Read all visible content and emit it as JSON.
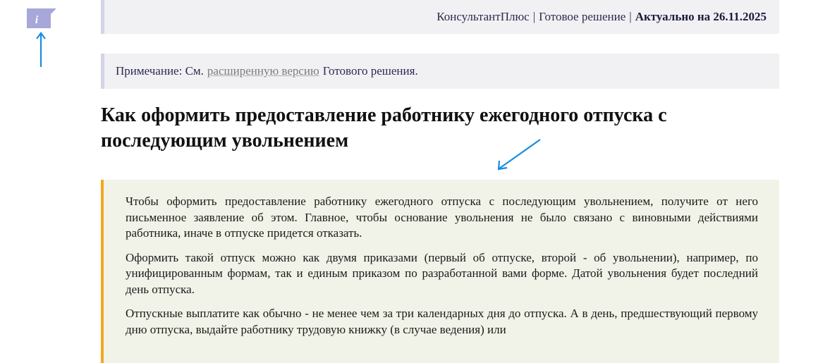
{
  "icons": {
    "info_icon": "info-icon",
    "annotation_arrow_up": "arrow-up-icon",
    "annotation_arrow_diagonal": "arrow-diagonal-icon",
    "info_glyph": "i"
  },
  "colors": {
    "header_bg": "#f1f1f4",
    "header_border": "#d4d4e8",
    "summary_bg": "#f1f3e8",
    "summary_border": "#f4a623",
    "annotation_arrow": "#1a8ce0",
    "info_icon": "#a7a7da"
  },
  "header": {
    "source": "КонсультантПлюс",
    "separator": "|",
    "doc_type": "Готовое решение",
    "actual_label": "Актуально на 26.11.2025"
  },
  "note": {
    "prefix": "Примечание: См.",
    "link_text": "расширенную версию",
    "suffix": "Готового решения."
  },
  "title": "Как оформить предоставление работнику ежегодного отпуска с последующим увольнением",
  "summary": {
    "paragraphs": [
      "Чтобы оформить предоставление работнику ежегодного отпуска с последующим увольнением, получите от него письменное заявление об этом. Главное, чтобы основание увольнения не было связано с виновными действиями работника, иначе в отпуске придется отказать.",
      "Оформить такой отпуск можно как двумя приказами (первый об отпуске, второй - об увольнении), например, по унифицированным формам, так и единым приказом по разработанной вами форме. Датой увольнения будет последний день отпуска.",
      "Отпускные выплатите как обычно - не менее чем за три календарных дня до отпуска. А в день, предшествующий первому дню отпуска, выдайте работнику трудовую книжку (в случае ведения) или"
    ]
  }
}
